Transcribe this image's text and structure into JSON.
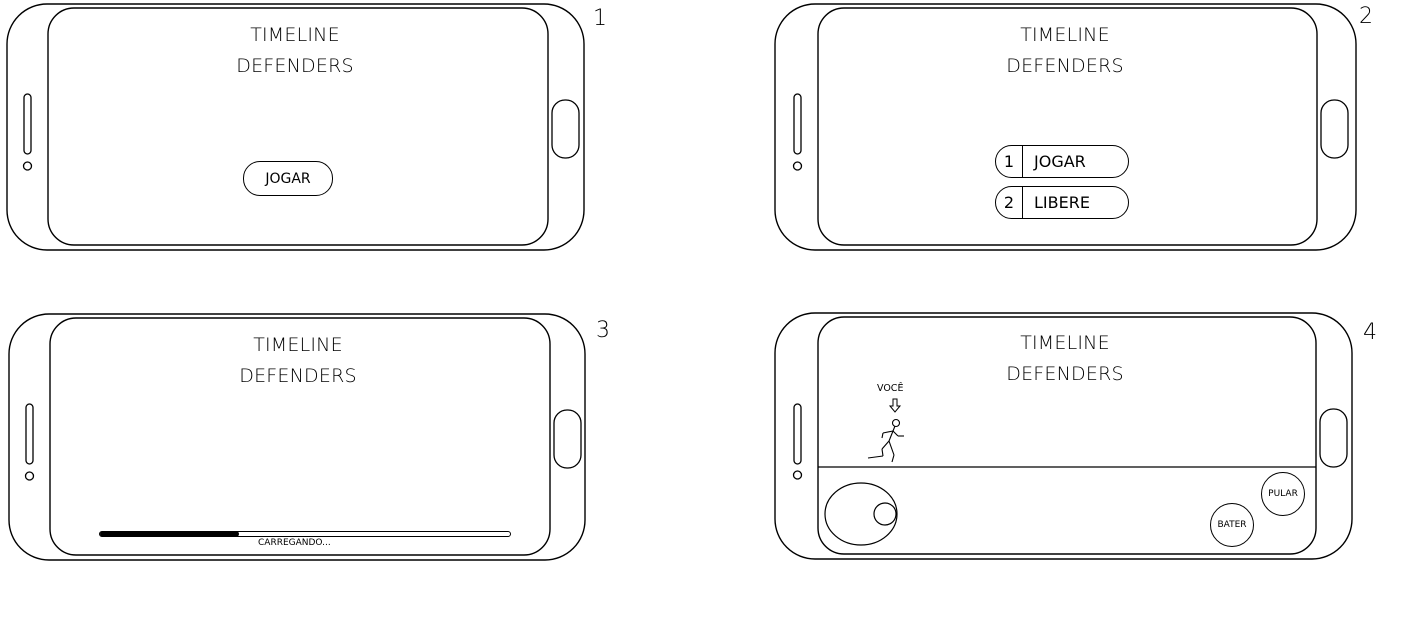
{
  "screens": [
    {
      "number": "1",
      "title_line1": "TIMELINE",
      "title_line2": "DEFENDERS",
      "play_button": "JOGAR"
    },
    {
      "number": "2",
      "title_line1": "TIMELINE",
      "title_line2": "DEFENDERS",
      "options": [
        {
          "index": "1",
          "label": "JOGAR"
        },
        {
          "index": "2",
          "label": "LIBERE"
        }
      ]
    },
    {
      "number": "3",
      "title_line1": "TIMELINE",
      "title_line2": "DEFENDERS",
      "loading_label": "CARREGANDO...",
      "loading_progress": 0.34
    },
    {
      "number": "4",
      "title_line1": "TIMELINE",
      "title_line2": "DEFENDERS",
      "player_label": "VOCÊ",
      "attack_button": "BATER",
      "jump_button": "PULAR"
    }
  ]
}
